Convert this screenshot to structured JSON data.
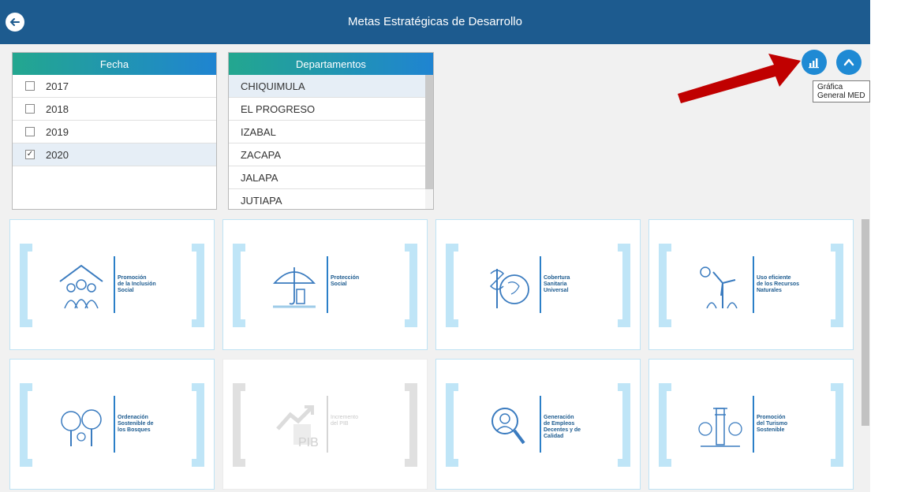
{
  "header": {
    "title": "Metas Estratégicas de Desarrollo"
  },
  "fecha": {
    "title": "Fecha",
    "items": [
      {
        "label": "2017",
        "checked": false
      },
      {
        "label": "2018",
        "checked": false
      },
      {
        "label": "2019",
        "checked": false
      },
      {
        "label": "2020",
        "checked": true
      }
    ]
  },
  "departamentos": {
    "title": "Departamentos",
    "items": [
      "CHIQUIMULA",
      "EL PROGRESO",
      "IZABAL",
      "ZACAPA",
      "JALAPA",
      "JUTIAPA"
    ],
    "selected": "CHIQUIMULA"
  },
  "tooltip": "Gráfica General MED",
  "tiles": [
    {
      "label": "Promoción\nde la Inclusión\nSocial",
      "icon": "people-house-icon",
      "enabled": true
    },
    {
      "label": "Protección\nSocial",
      "icon": "umbrella-icon",
      "enabled": true
    },
    {
      "label": "Cobertura\nSanitaria\nUniversal",
      "icon": "caduceus-globe-icon",
      "enabled": true
    },
    {
      "label": "Uso eficiente\nde los Recursos\nNaturales",
      "icon": "wind-turbine-icon",
      "enabled": true
    },
    {
      "label": "Ordenación\nSostenible de\nlos Bosques",
      "icon": "trees-icon",
      "enabled": true
    },
    {
      "label": "Incremento\ndel PIB",
      "icon": "pib-chart-icon",
      "enabled": false
    },
    {
      "label": "Generación\nde Empleos\nDecentes y de\nCalidad",
      "icon": "worker-magnifier-icon",
      "enabled": true
    },
    {
      "label": "Promoción\ndel Turismo\nSostenible",
      "icon": "monument-icon",
      "enabled": true
    }
  ],
  "colors": {
    "header": "#1d5b8f",
    "accent": "#1f8ad4",
    "arrow": "#c00000"
  }
}
